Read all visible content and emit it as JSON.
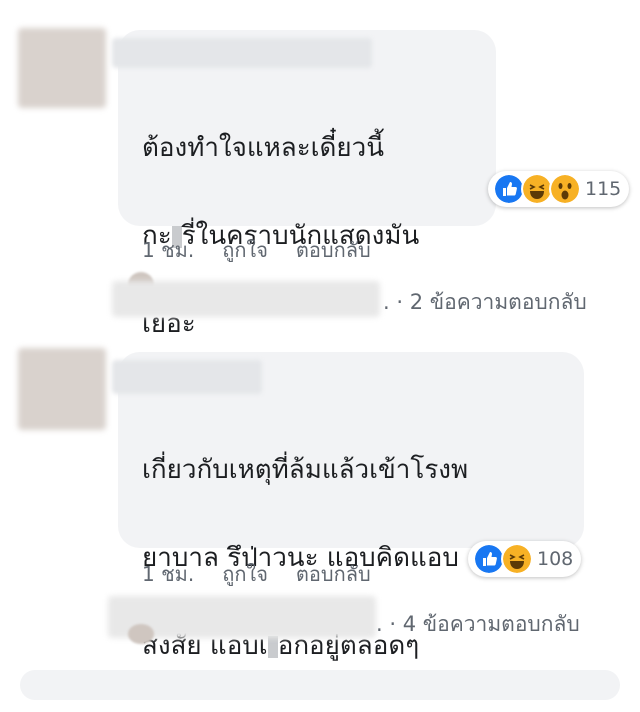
{
  "comments": [
    {
      "line1": "ต้องทำใจแหละเดี๋ยวนี้",
      "line2_pre": "กะ",
      "line2_post": "รี่ในคราบนักแสดงมัน",
      "line3": "เยอะ",
      "reaction_count": "115",
      "reactions": [
        "like-icon",
        "haha-icon",
        "wow-icon"
      ],
      "time": "1 ชม.",
      "like_label": "ถูกใจ",
      "reply_label": "ตอบกลับ",
      "replies_text": "2 ข้อความตอบกลับ"
    },
    {
      "line1": "เกี่ยวกับเหตุที่ล้มแล้วเข้าโรงพ",
      "line2": "ยาบาล รึป่าวนะ แอบคิดแอบ",
      "line3_pre": "สงสัย แอบเ",
      "line3_post": "อกอยู่ตลอดๆ",
      "reaction_count": "108",
      "reactions": [
        "like-icon",
        "haha-icon"
      ],
      "time": "1 ชม.",
      "like_label": "ถูกใจ",
      "reply_label": "ตอบกลับ",
      "replies_text": "4 ข้อความตอบกลับ"
    }
  ],
  "colors": {
    "bubble": "#f2f3f5",
    "like": "#1877f2",
    "emoji": "#f7b125",
    "meta": "#606770"
  }
}
